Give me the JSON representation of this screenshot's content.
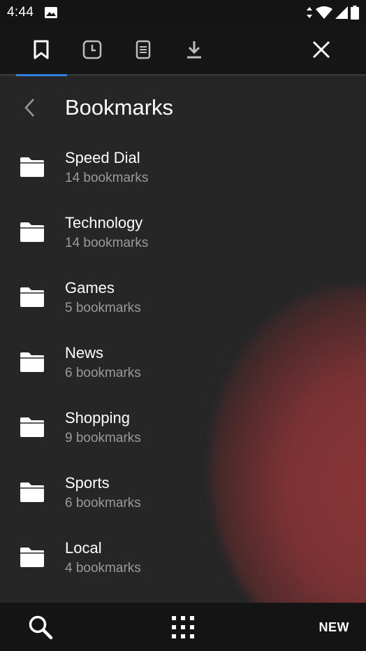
{
  "status_bar": {
    "time": "4:44",
    "icons": [
      "image-icon",
      "data-arrows-icon",
      "wifi-icon",
      "signal-icon",
      "battery-icon"
    ]
  },
  "tabs": [
    {
      "name": "bookmarks",
      "icon": "bookmark-icon",
      "selected": true
    },
    {
      "name": "history",
      "icon": "clock-icon",
      "selected": false
    },
    {
      "name": "reading-list",
      "icon": "document-icon",
      "selected": false
    },
    {
      "name": "downloads",
      "icon": "download-icon",
      "selected": false
    }
  ],
  "header": {
    "title": "Bookmarks"
  },
  "folders": [
    {
      "title": "Speed Dial",
      "subtitle": "14 bookmarks"
    },
    {
      "title": "Technology",
      "subtitle": "14 bookmarks"
    },
    {
      "title": "Games",
      "subtitle": "5 bookmarks"
    },
    {
      "title": "News",
      "subtitle": "6 bookmarks"
    },
    {
      "title": "Shopping",
      "subtitle": "9 bookmarks"
    },
    {
      "title": "Sports",
      "subtitle": "6 bookmarks"
    },
    {
      "title": "Local",
      "subtitle": "4 bookmarks"
    }
  ],
  "bottom_bar": {
    "new_label": "NEW"
  },
  "colors": {
    "accent": "#2f7fe0",
    "background": "#262627",
    "bar": "#141414",
    "subtitle": "#9a9a9a"
  }
}
